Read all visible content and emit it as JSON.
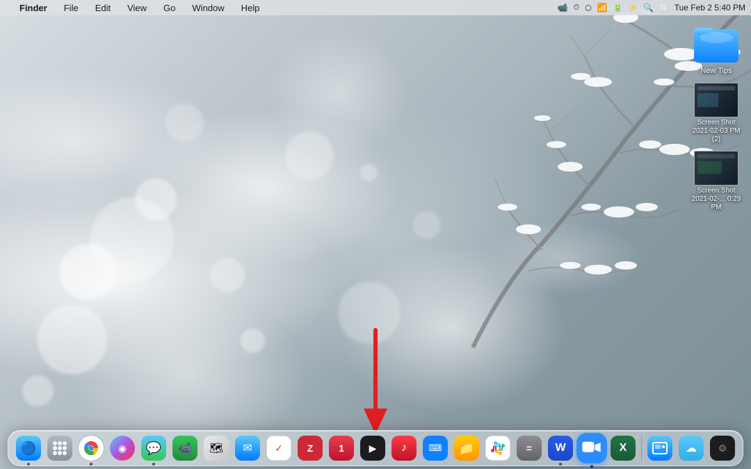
{
  "desktop": {
    "background": "snowy bokeh winter scene"
  },
  "menubar": {
    "apple_label": "",
    "app_name": "Finder",
    "menus": [
      "File",
      "Edit",
      "View",
      "Go",
      "Window",
      "Help"
    ],
    "datetime": "Tue Feb 2  5:40 PM",
    "status_icons": [
      "facetime-icon",
      "screentime-icon",
      "airplay-icon",
      "wifi-icon",
      "battery-icon",
      "bluetooth-icon",
      "search-icon",
      "screenrecord-icon",
      "control-icon"
    ]
  },
  "desktop_icons": [
    {
      "name": "new-tips-folder",
      "label": "New Tips",
      "type": "folder"
    },
    {
      "name": "screenshot-1",
      "label": "Screen Shot 2021-02-03 PM (2)",
      "type": "screenshot"
    },
    {
      "name": "screenshot-2",
      "label": "Screen Shot 2021-02-... 0:29 PM",
      "type": "screenshot"
    }
  ],
  "arrow": {
    "color": "#e02020",
    "direction": "down"
  },
  "dock": {
    "items": [
      {
        "id": "finder",
        "label": "Finder",
        "icon": "🔵",
        "css_class": "app-finder",
        "has_dot": true
      },
      {
        "id": "launchpad",
        "label": "Launchpad",
        "icon": "⚪",
        "css_class": "app-launchpad",
        "has_dot": false
      },
      {
        "id": "chrome",
        "label": "Google Chrome",
        "icon": "🌐",
        "css_class": "app-chrome",
        "has_dot": true
      },
      {
        "id": "siri",
        "label": "Siri",
        "icon": "◎",
        "css_class": "app-siri",
        "has_dot": false
      },
      {
        "id": "messages",
        "label": "Messages",
        "icon": "💬",
        "css_class": "app-messages",
        "has_dot": true
      },
      {
        "id": "facetime",
        "label": "FaceTime",
        "icon": "📹",
        "css_class": "app-facetime",
        "has_dot": false
      },
      {
        "id": "maps",
        "label": "Maps",
        "icon": "🗺",
        "css_class": "app-maps",
        "has_dot": false
      },
      {
        "id": "mail",
        "label": "Mail",
        "icon": "✉",
        "css_class": "app-mail",
        "has_dot": false
      },
      {
        "id": "reminders",
        "label": "Reminders",
        "icon": "✓",
        "css_class": "app-reminders",
        "has_dot": false
      },
      {
        "id": "zotero",
        "label": "Zotero",
        "icon": "Z",
        "css_class": "app-zotero",
        "has_dot": false
      },
      {
        "id": "one",
        "label": "ONE",
        "icon": "1",
        "css_class": "app-one",
        "has_dot": false
      },
      {
        "id": "apple-tv",
        "label": "Apple TV",
        "icon": "▶",
        "css_class": "app-apple-tv",
        "has_dot": false
      },
      {
        "id": "music",
        "label": "Music",
        "icon": "♪",
        "css_class": "app-music",
        "has_dot": false
      },
      {
        "id": "xcode",
        "label": "Xcode",
        "icon": "⌨",
        "css_class": "app-xcode",
        "has_dot": false
      },
      {
        "id": "folder",
        "label": "Folder",
        "icon": "📁",
        "css_class": "app-folder",
        "has_dot": false
      },
      {
        "id": "slack",
        "label": "Slack",
        "icon": "#",
        "css_class": "app-slack",
        "has_dot": false
      },
      {
        "id": "calculator",
        "label": "Calculator",
        "icon": "=",
        "css_class": "app-calc",
        "has_dot": false
      },
      {
        "id": "word",
        "label": "Microsoft Word",
        "icon": "W",
        "css_class": "app-word",
        "has_dot": true
      },
      {
        "id": "zoom",
        "label": "Zoom",
        "icon": "📹",
        "css_class": "app-zoom",
        "has_dot": true,
        "highlighted": true
      },
      {
        "id": "excel",
        "label": "Microsoft Excel",
        "icon": "X",
        "css_class": "app-excel",
        "has_dot": false
      },
      {
        "id": "screenshot",
        "label": "Screenshot",
        "icon": "⬜",
        "css_class": "app-screenshot",
        "has_dot": false
      },
      {
        "id": "icloud",
        "label": "iCloud",
        "icon": "☁",
        "css_class": "app-icloud",
        "has_dot": false
      },
      {
        "id": "toolbox",
        "label": "Toolbox",
        "icon": "⚙",
        "css_class": "app-toolbox",
        "has_dot": false
      }
    ]
  }
}
